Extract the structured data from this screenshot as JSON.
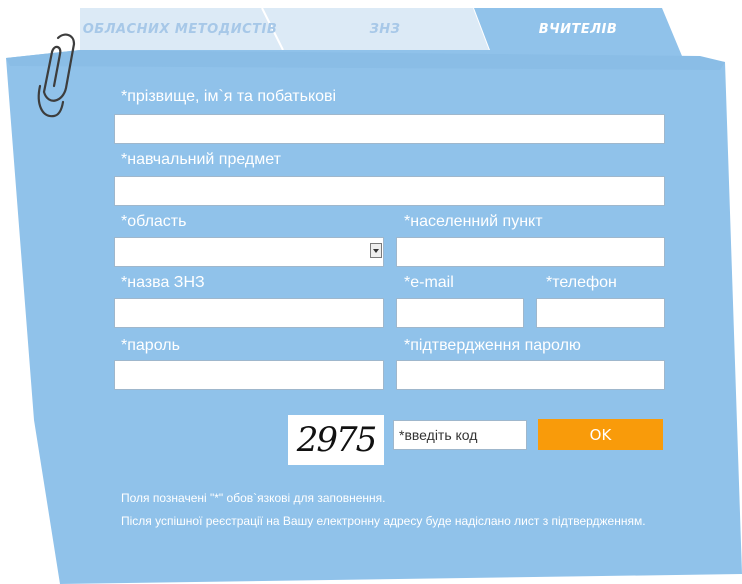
{
  "tabs": [
    {
      "label": "ОБЛАСНИХ МЕТОДИСТІВ",
      "active": false
    },
    {
      "label": "ЗНЗ",
      "active": false
    },
    {
      "label": "ВЧИТЕЛІВ",
      "active": true
    }
  ],
  "form": {
    "full_name_label": "*прізвище, ім`я та побатькові",
    "subject_label": "*навчальний предмет",
    "region_label": "*область",
    "settlement_label": "*населенний пункт",
    "school_label": "*назва ЗНЗ",
    "email_label": "*e-mail",
    "phone_label": "*телефон",
    "password_label": "*пароль",
    "password_confirm_label": "*підтвердження паролю"
  },
  "captcha": {
    "code": "2975",
    "placeholder": "*введіть код"
  },
  "ok_label": "OK",
  "notes": {
    "required": "Поля позначені \"*\" обов`язкові для заповнення.",
    "confirmation": "Після успішної реєстрації на Вашу електронну адресу буде надіслано лист з підтвердженням."
  },
  "colors": {
    "panel": "#90c2ea",
    "inactive_tab": "#dceaf6",
    "button": "#f99b0a"
  }
}
